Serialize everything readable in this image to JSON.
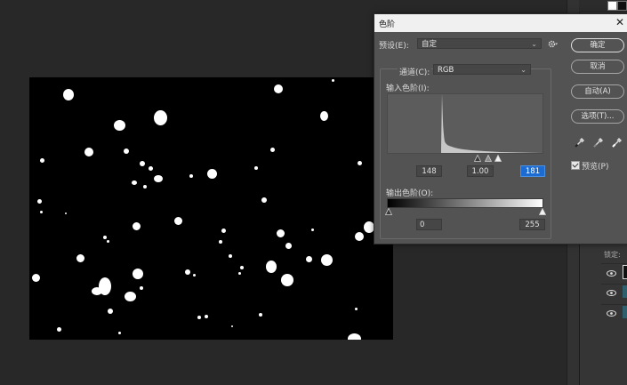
{
  "dialog": {
    "title": "色阶",
    "close_glyph": "✕",
    "preset_label": "预设(E):",
    "preset_value": "自定",
    "channel_label": "通道(C):",
    "channel_value": "RGB",
    "input_levels_label": "输入色阶(I):",
    "input_values": {
      "black": "148",
      "mid": "1.00",
      "white": "181"
    },
    "output_levels_label": "输出色阶(O):",
    "output_values": {
      "black": "0",
      "white": "255"
    },
    "buttons": {
      "ok": "确定",
      "cancel": "取消",
      "auto": "自动(A)",
      "options": "选项(T)..."
    },
    "preview_label": "预览(P)",
    "preview_checked": true
  },
  "right_panel": {
    "lock_label": "锁定:"
  },
  "icons": {
    "gear": "gear-icon",
    "black_eyedropper": "eyedropper-black-icon",
    "gray_eyedropper": "eyedropper-gray-icon",
    "white_eyedropper": "eyedropper-white-icon",
    "eye": "eye-icon"
  },
  "colors": {
    "dialog_bg": "#535353",
    "workspace_bg": "#282828",
    "selected_field": "#1b6bd2"
  }
}
